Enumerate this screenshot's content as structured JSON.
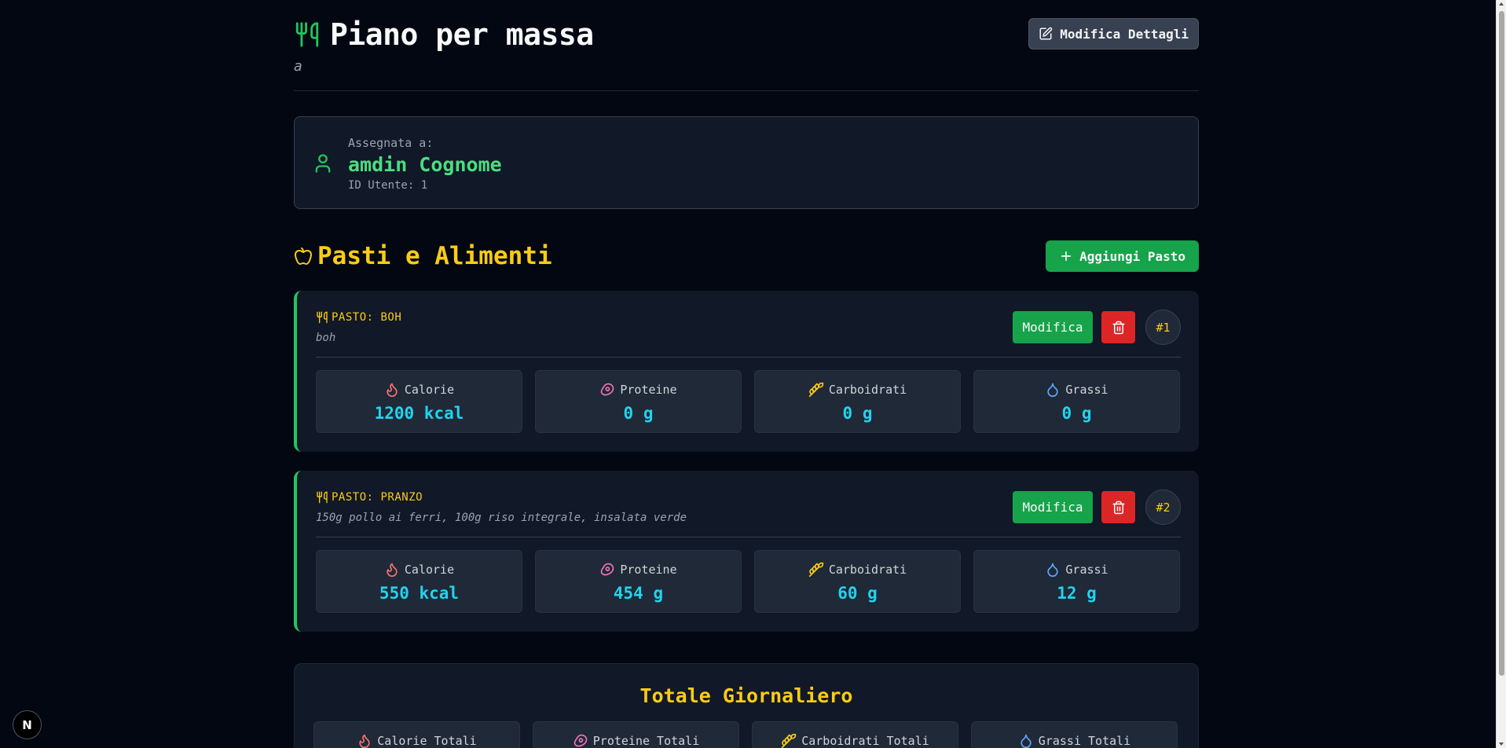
{
  "header": {
    "title": "Piano per massa",
    "subtitle": "a",
    "edit_button_label": "Modifica Dettagli"
  },
  "assignment": {
    "label": "Assegnata a:",
    "name": "amdin Cognome",
    "user_id": "ID Utente: 1"
  },
  "meals_section": {
    "title": "Pasti e Alimenti",
    "add_button_label": "Aggiungi Pasto"
  },
  "macro_labels": {
    "calories": "Calorie",
    "protein": "Proteine",
    "carbs": "Carboidrati",
    "fat": "Grassi"
  },
  "meals": [
    {
      "name": "PASTO: BOH",
      "description": "boh",
      "modify_label": "Modifica",
      "number": "#1",
      "calories": "1200 kcal",
      "protein": "0 g",
      "carbs": "0 g",
      "fat": "0 g"
    },
    {
      "name": "PASTO: PRANZO",
      "description": "150g pollo ai ferri, 100g riso integrale, insalata verde",
      "modify_label": "Modifica",
      "number": "#2",
      "calories": "550 kcal",
      "protein": "454 g",
      "carbs": "60 g",
      "fat": "12 g"
    }
  ],
  "totals": {
    "title": "Totale Giornaliero",
    "calories_label": "Calorie Totali",
    "protein_label": "Proteine Totali",
    "carbs_label": "Carboidrati Totali",
    "fat_label": "Grassi Totali"
  },
  "badge": {
    "label": "N"
  },
  "colors": {
    "background": "#030712",
    "accent_green": "#16a34a",
    "accent_yellow": "#facc15",
    "value_cyan": "#22d3ee",
    "danger_red": "#dc2626",
    "name_green": "#4ade80"
  },
  "icons": {
    "title": "utensils-icon",
    "edit": "pencil-square-icon",
    "user": "user-icon",
    "section": "apple-icon",
    "add": "plus-icon",
    "delete": "trash-icon",
    "calories": "flame-icon",
    "protein": "meat-icon",
    "carbs": "wheat-icon",
    "fat": "droplet-icon"
  }
}
